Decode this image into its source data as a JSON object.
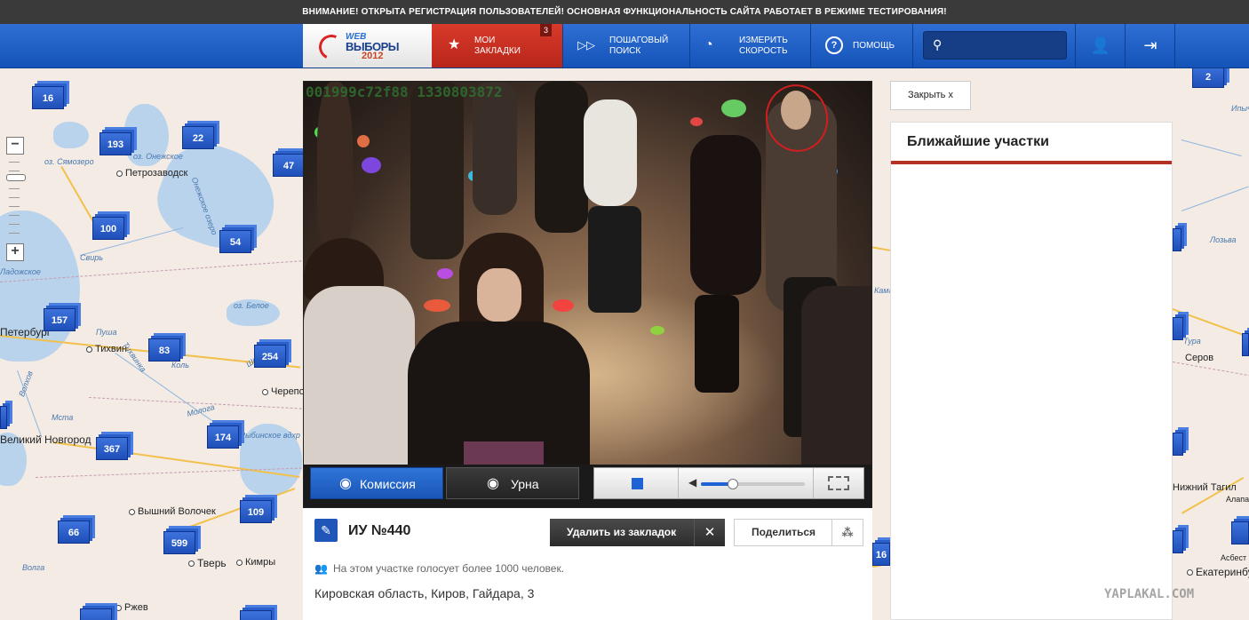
{
  "notice": "ВНИМАНИЕ! ОТКРЫТА РЕГИСТРАЦИЯ ПОЛЬЗОВАТЕЛЕЙ! ОСНОВНАЯ ФУНКЦИОНАЛЬНОСТЬ САЙТА РАБОТАЕТ В РЕЖИМЕ ТЕСТИРОВАНИЯ!",
  "logo": {
    "line1": "WEB",
    "line2": "ВЫБОРЫ",
    "line3": "2012"
  },
  "nav": {
    "bookmarks": {
      "line1": "МОИ",
      "line2": "ЗАКЛАДКИ",
      "badge": "3"
    },
    "step_search": {
      "line1": "ПОШАГОВЫЙ",
      "line2": "ПОИСК"
    },
    "speed": {
      "line1": "ИЗМЕРИТЬ",
      "line2": "СКОРОСТЬ"
    },
    "help": {
      "line1": "ПОМОЩЬ"
    }
  },
  "search": {
    "value": "",
    "placeholder": ""
  },
  "colors": {
    "header_blue": "#1f5fc6",
    "bookmarks_red": "#c8301f",
    "accent_red": "#b53020",
    "cluster_blue": "#2556c4"
  },
  "icons": {
    "bookmarks": "star-icon",
    "step_search": "forward-icon",
    "speed": "speedometer-icon",
    "help": "help-icon",
    "search": "search-icon",
    "user": "user-icon",
    "logout": "logout-icon",
    "camera": "camera-icon",
    "stop": "stop-icon",
    "volume": "volume-icon",
    "fullscreen": "fullscreen-icon"
  },
  "map": {
    "clusters": [
      "16",
      "193",
      "22",
      "47",
      "100",
      "54",
      "157",
      "83",
      "254",
      "174",
      "367",
      "66",
      "599",
      "109",
      "2",
      "16"
    ],
    "cities": [
      "Петрозаводск",
      "Петербург",
      "Тихвин",
      "Череповец",
      "Великий Новгород",
      "Вышний Волочек",
      "Тверь",
      "Ржев",
      "Кимры",
      "Серов",
      "Нижний Тагил",
      "Екатеринбург",
      "Асбест",
      "Алапаевск"
    ],
    "water": [
      "оз. Сямозеро",
      "оз. Онежское",
      "Онежское озеро",
      "оз. Белое",
      "Ладожское",
      "Рыбинское вдхр",
      "Молога",
      "Свирь",
      "Волхов",
      "Мста",
      "Шексна",
      "Пуша",
      "Тихвинка",
      "Коль",
      "Волга",
      "Ипыч",
      "Лозьва",
      "Тура",
      "Кама"
    ]
  },
  "video": {
    "stamp": "001999c72f88 1330803872",
    "camera_commission": "Комиссия",
    "camera_urn": "Урна",
    "volume_level": 0.3
  },
  "uik": {
    "title": "ИУ №440",
    "remove_bookmark": "Удалить из закладок",
    "share": "Поделиться",
    "voters_note": "На этом участке голосует более 1000 человек.",
    "address": "Кировская область, Киров, Гайдара, 3"
  },
  "panel": {
    "close": "Закрыть  х",
    "nearby_title": "Ближайшие участки"
  },
  "watermark": "YAPLAKAL.COM"
}
